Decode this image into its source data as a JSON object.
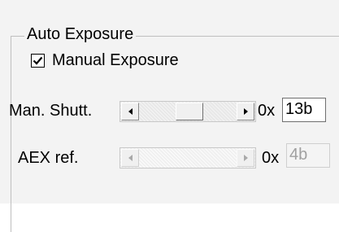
{
  "group": {
    "title": "Auto Exposure"
  },
  "manual_exposure": {
    "label": "Manual Exposure",
    "checked": true
  },
  "shutter": {
    "label": "Man. Shutt.",
    "prefix": "0x",
    "value": "13b",
    "enabled": true,
    "slider_position": 0.55
  },
  "aex_ref": {
    "label": "AEX ref.",
    "prefix": "0x",
    "value": "4b",
    "enabled": false
  }
}
